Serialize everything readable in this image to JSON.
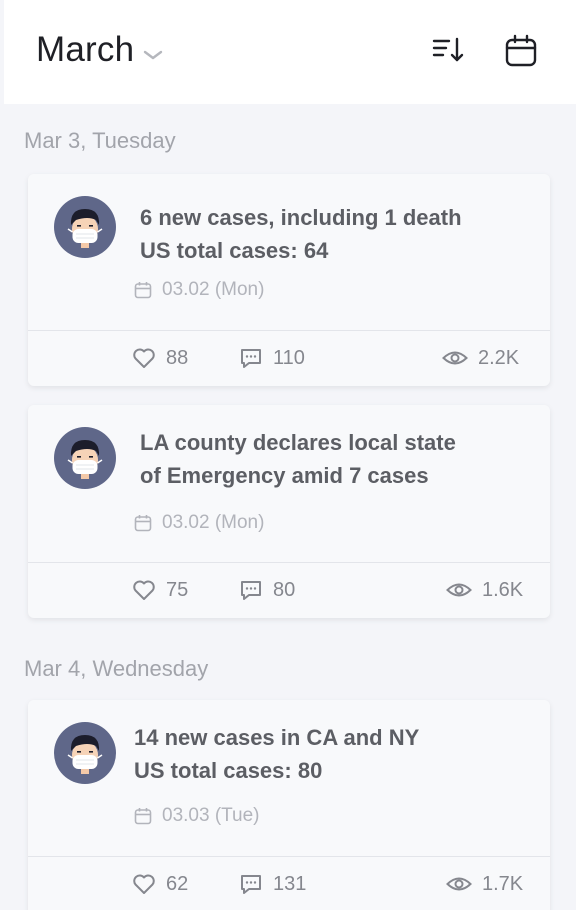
{
  "header": {
    "title": "March",
    "icons": {
      "dropdown": "chevron-down-icon",
      "sort": "sort-descending-icon",
      "calendar": "calendar-icon"
    }
  },
  "sections": [
    {
      "label": "Mar 3, Tuesday",
      "cards": [
        {
          "headline_lines": [
            "6 new cases, including 1 death",
            "US total cases: 64"
          ],
          "date": "03.02 (Mon)",
          "likes": "88",
          "comments": "110",
          "views": "2.2K"
        },
        {
          "headline_lines": [
            "LA county declares local state",
            "of Emergency amid 7 cases"
          ],
          "date": "03.02 (Mon)",
          "likes": "75",
          "comments": "80",
          "views": "1.6K"
        }
      ]
    },
    {
      "label": "Mar 4, Wednesday",
      "cards": [
        {
          "headline_lines": [
            "14 new cases in CA and NY",
            "US total cases: 80"
          ],
          "date": "03.03 (Tue)",
          "likes": "62",
          "comments": "131",
          "views": "1.7K"
        }
      ]
    }
  ],
  "colors": {
    "background": "#f4f5f9",
    "card": "#f8f9fb",
    "title": "#1f2026",
    "headline": "#5c5e64",
    "muted": "#a2a4ab",
    "avatar_bg": "#5f6789",
    "mask": "#ffffff"
  }
}
